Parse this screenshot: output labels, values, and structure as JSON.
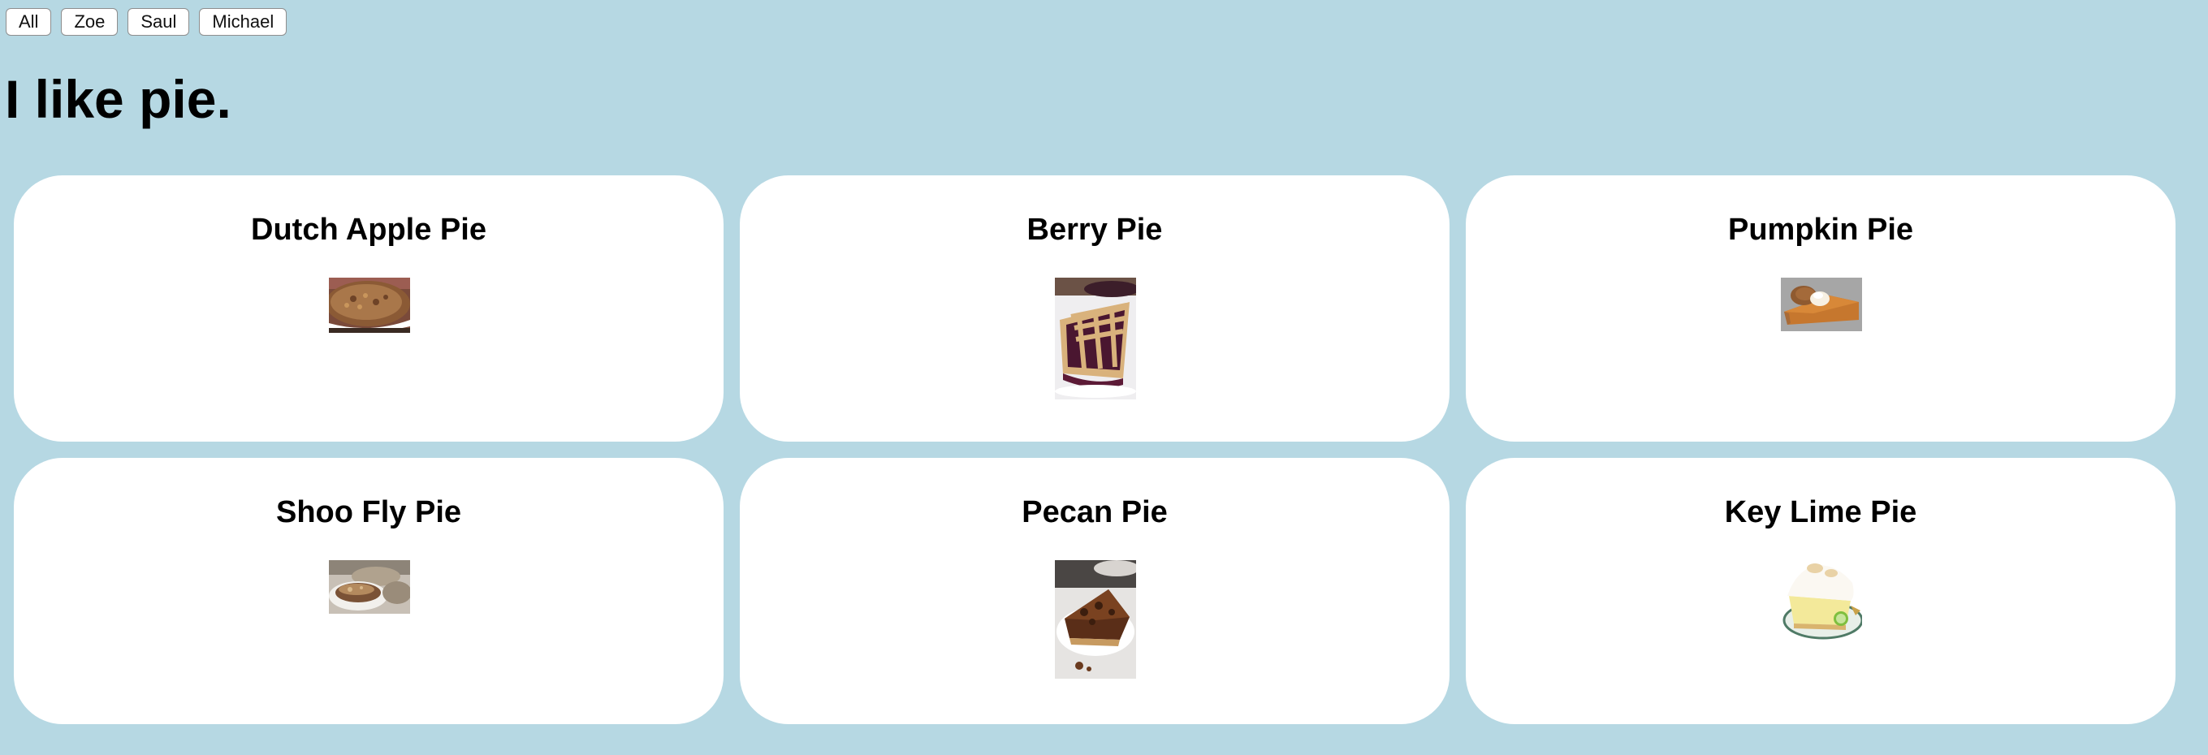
{
  "filters": [
    {
      "label": "All"
    },
    {
      "label": "Zoe"
    },
    {
      "label": "Saul"
    },
    {
      "label": "Michael"
    }
  ],
  "title": "I like pie.",
  "pies": [
    {
      "name": "Dutch Apple Pie",
      "image_icon": "dutch-apple-pie-photo"
    },
    {
      "name": "Berry Pie",
      "image_icon": "berry-pie-photo"
    },
    {
      "name": "Pumpkin Pie",
      "image_icon": "pumpkin-pie-photo"
    },
    {
      "name": "Shoo Fly Pie",
      "image_icon": "shoo-fly-pie-photo"
    },
    {
      "name": "Pecan Pie",
      "image_icon": "pecan-pie-photo"
    },
    {
      "name": "Key Lime Pie",
      "image_icon": "key-lime-pie-photo"
    }
  ],
  "colors": {
    "background": "#b6d8e3",
    "card": "#ffffff"
  }
}
